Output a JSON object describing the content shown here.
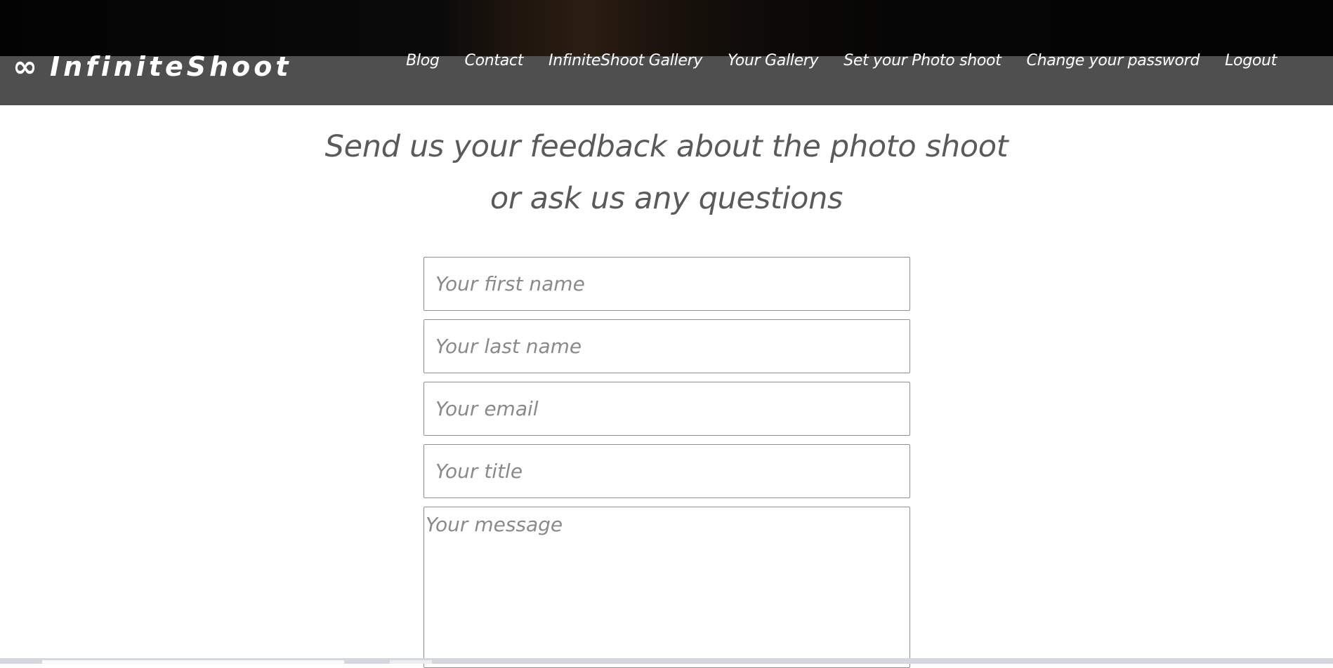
{
  "brand": {
    "icon": "infinity-icon",
    "icon_glyph": "∞",
    "name": "InfiniteShoot"
  },
  "nav": {
    "items": [
      {
        "label": "Blog"
      },
      {
        "label": "Contact"
      },
      {
        "label": "InfiniteShoot Gallery"
      },
      {
        "label": "Your Gallery"
      },
      {
        "label": "Set your Photo shoot"
      },
      {
        "label": "Change your password"
      },
      {
        "label": "Logout"
      }
    ]
  },
  "heading": {
    "line1": "Send us your feedback about the photo shoot",
    "line2": "or ask us any questions"
  },
  "form": {
    "first_name": {
      "placeholder": "Your first name",
      "value": ""
    },
    "last_name": {
      "placeholder": "Your last name",
      "value": ""
    },
    "email": {
      "placeholder": "Your email",
      "value": ""
    },
    "title": {
      "placeholder": "Your title",
      "value": ""
    },
    "message": {
      "placeholder": "Your message",
      "value": ""
    }
  },
  "colors": {
    "navbar": "#4f4f4f",
    "heading_text": "#5a5a5a",
    "nav_text": "#ffffff"
  }
}
